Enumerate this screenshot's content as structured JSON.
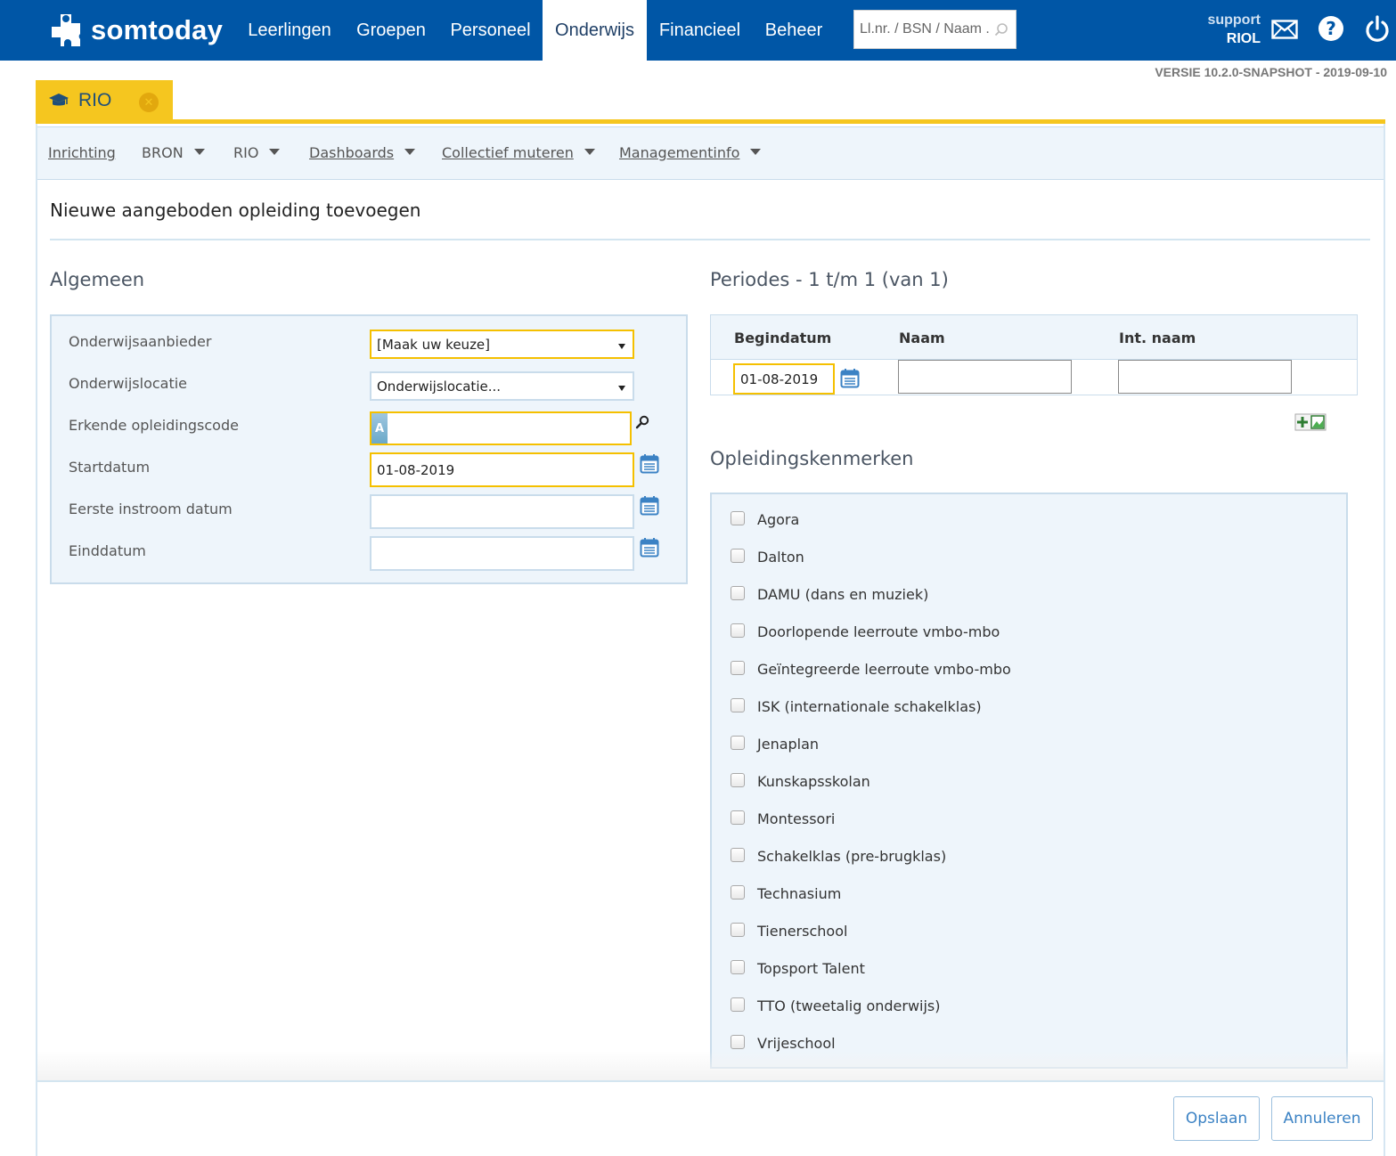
{
  "brand": {
    "name": "somtoday",
    "logo_icon": "puzzle-cross-icon"
  },
  "nav": {
    "items": [
      {
        "label": "Leerlingen",
        "active": false
      },
      {
        "label": "Groepen",
        "active": false
      },
      {
        "label": "Personeel",
        "active": false
      },
      {
        "label": "Onderwijs",
        "active": true
      },
      {
        "label": "Financieel",
        "active": false
      },
      {
        "label": "Beheer",
        "active": false
      }
    ],
    "search_placeholder": "Ll.nr. / BSN / Naam ...",
    "user_role": "support",
    "user_name": "RIOL",
    "icons": [
      "mail-icon",
      "help-icon",
      "power-icon"
    ]
  },
  "version": "VERSIE 10.2.0-SNAPSHOT - 2019-09-10",
  "tab": {
    "label": "RIO",
    "icon": "graduation-cap-icon",
    "close_icon": "close-icon"
  },
  "subnav": {
    "items": [
      {
        "label": "Inrichting",
        "dropdown": false
      },
      {
        "label": "BRON",
        "dropdown": true
      },
      {
        "label": "RIO",
        "dropdown": true
      },
      {
        "label": "Dashboards",
        "dropdown": true
      },
      {
        "label": "Collectief muteren",
        "dropdown": true
      },
      {
        "label": "Managementinfo",
        "dropdown": true
      }
    ]
  },
  "page": {
    "title": "Nieuwe aangeboden opleiding toevoegen"
  },
  "algemeen": {
    "heading": "Algemeen",
    "fields": {
      "onderwijsaanbieder": {
        "label": "Onderwijsaanbieder",
        "value": "[Maak uw keuze]"
      },
      "onderwijslocatie": {
        "label": "Onderwijslocatie",
        "value": "Onderwijslocatie..."
      },
      "opleidingscode": {
        "label": "Erkende opleidingscode",
        "value": ""
      },
      "startdatum": {
        "label": "Startdatum",
        "value": "01-08-2019"
      },
      "instroom": {
        "label": "Eerste instroom datum",
        "value": ""
      },
      "einddatum": {
        "label": "Einddatum",
        "value": ""
      }
    }
  },
  "periodes": {
    "heading": "Periodes - 1 t/m 1 (van 1)",
    "columns": [
      "Begindatum",
      "Naam",
      "Int. naam"
    ],
    "rows": [
      {
        "begindatum": "01-08-2019",
        "naam": "",
        "int_naam": ""
      }
    ]
  },
  "kenmerken": {
    "heading": "Opleidingskenmerken",
    "items": [
      "Agora",
      "Dalton",
      "DAMU (dans en muziek)",
      "Doorlopende leerroute vmbo-mbo",
      "Geïntegreerde leerroute vmbo-mbo",
      "ISK (internationale schakelklas)",
      "Jenaplan",
      "Kunskapsskolan",
      "Montessori",
      "Schakelklas (pre-brugklas)",
      "Technasium",
      "Tienerschool",
      "Topsport Talent",
      "TTO (tweetalig onderwijs)",
      "Vrijeschool"
    ]
  },
  "buttons": {
    "save": "Opslaan",
    "cancel": "Annuleren"
  },
  "colors": {
    "topbar": "#0056a6",
    "accent": "#f5c61f",
    "panel": "#eef5fb",
    "border": "#c9dceb",
    "link": "#3b82c4"
  }
}
